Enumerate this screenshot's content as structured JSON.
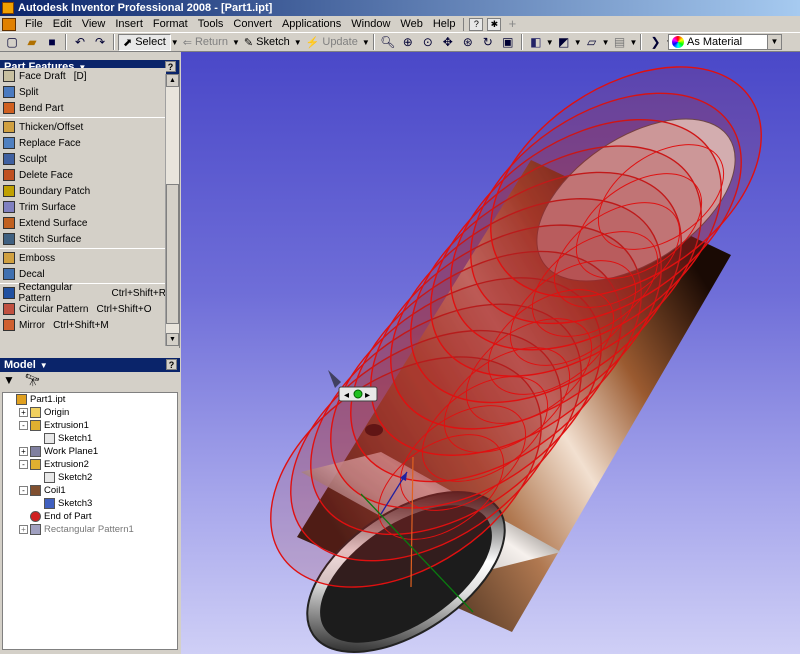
{
  "window": {
    "title": "Autodesk Inventor Professional 2008 - [Part1.ipt]"
  },
  "menu": {
    "items": [
      "File",
      "Edit",
      "View",
      "Insert",
      "Format",
      "Tools",
      "Convert",
      "Applications",
      "Window",
      "Web",
      "Help"
    ]
  },
  "toolbar": {
    "select_label": "Select",
    "return_label": "Return",
    "sketch_label": "Sketch",
    "update_label": "Update",
    "material_value": "As Material"
  },
  "part_features": {
    "title": "Part Features",
    "items": [
      {
        "label": "Face Draft",
        "shortcut": "[D]",
        "icon": "face-draft-icon"
      },
      {
        "label": "Split",
        "shortcut": "",
        "icon": "split-icon"
      },
      {
        "label": "Bend Part",
        "shortcut": "",
        "icon": "bend-part-icon"
      },
      {
        "label": "Thicken/Offset",
        "shortcut": "",
        "icon": "thicken-icon"
      },
      {
        "label": "Replace Face",
        "shortcut": "",
        "icon": "replace-face-icon"
      },
      {
        "label": "Sculpt",
        "shortcut": "",
        "icon": "sculpt-icon"
      },
      {
        "label": "Delete Face",
        "shortcut": "",
        "icon": "delete-face-icon"
      },
      {
        "label": "Boundary Patch",
        "shortcut": "",
        "icon": "boundary-patch-icon"
      },
      {
        "label": "Trim Surface",
        "shortcut": "",
        "icon": "trim-surface-icon"
      },
      {
        "label": "Extend Surface",
        "shortcut": "",
        "icon": "extend-surface-icon"
      },
      {
        "label": "Stitch Surface",
        "shortcut": "",
        "icon": "stitch-surface-icon"
      },
      {
        "label": "Emboss",
        "shortcut": "",
        "icon": "emboss-icon"
      },
      {
        "label": "Decal",
        "shortcut": "",
        "icon": "decal-icon"
      },
      {
        "label": "Rectangular Pattern",
        "shortcut": "Ctrl+Shift+R",
        "icon": "rectangular-pattern-icon"
      },
      {
        "label": "Circular Pattern",
        "shortcut": "Ctrl+Shift+O",
        "icon": "circular-pattern-icon"
      },
      {
        "label": "Mirror",
        "shortcut": "Ctrl+Shift+M",
        "icon": "mirror-icon"
      }
    ]
  },
  "model": {
    "title": "Model",
    "tree": [
      {
        "label": "Part1.ipt",
        "level": 0,
        "expand": "",
        "dim": false
      },
      {
        "label": "Origin",
        "level": 1,
        "expand": "+",
        "dim": false
      },
      {
        "label": "Extrusion1",
        "level": 1,
        "expand": "-",
        "dim": false
      },
      {
        "label": "Sketch1",
        "level": 2,
        "expand": "",
        "dim": false
      },
      {
        "label": "Work Plane1",
        "level": 1,
        "expand": "+",
        "dim": false
      },
      {
        "label": "Extrusion2",
        "level": 1,
        "expand": "-",
        "dim": false
      },
      {
        "label": "Sketch2",
        "level": 2,
        "expand": "",
        "dim": false
      },
      {
        "label": "Coil1",
        "level": 1,
        "expand": "-",
        "dim": false
      },
      {
        "label": "Sketch3",
        "level": 2,
        "expand": "",
        "dim": false
      },
      {
        "label": "End of Part",
        "level": 1,
        "expand": "",
        "dim": false
      },
      {
        "label": "Rectangular Pattern1",
        "level": 1,
        "expand": "+",
        "dim": true
      }
    ]
  },
  "colors": {
    "title_bar": "#0a246a",
    "viewport_top": "#4a48c8",
    "viewport_bottom": "#cfcff6",
    "feature_edge": "#e01010"
  }
}
